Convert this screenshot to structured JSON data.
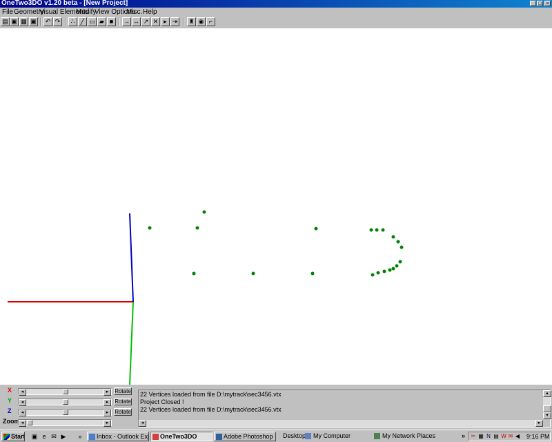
{
  "window": {
    "title": "OneTwo3DO  v1.20 beta - [New Project]"
  },
  "menu": [
    "File",
    "Geometry",
    "Visual Elements",
    "Modify",
    "View Options",
    "Misc.",
    "Help"
  ],
  "toolbar": {
    "groups": [
      [
        "open-icon",
        "save-icon",
        "save-as-icon",
        "save-all-icon"
      ],
      [
        "undo-icon",
        "redo-icon"
      ],
      [
        "vertex-icon",
        "line-icon",
        "face-icon",
        "surface-icon",
        "solid-icon"
      ],
      [
        "arrow-right-icon",
        "arrow-both-icon",
        "arrow-diagonal-icon",
        "crosshair-icon",
        "step-right-icon",
        "step-end-icon"
      ],
      [
        "render-icon",
        "view-icon",
        "pipeline-icon"
      ]
    ]
  },
  "viewport": {
    "axes": {
      "x_color": "#e00000",
      "y_color": "#0000c0",
      "z_color": "#00c000"
    },
    "vertex_color": "#008000"
  },
  "controls": {
    "rows": [
      {
        "axis": "X",
        "color": "#e00000",
        "button": "Rotate"
      },
      {
        "axis": "Y",
        "color": "#00a000",
        "button": "Rotate"
      },
      {
        "axis": "Z",
        "color": "#0000c0",
        "button": "Rotate"
      },
      {
        "axis": "Zoom",
        "color": "#000000",
        "button": ""
      }
    ]
  },
  "log": {
    "lines": [
      "22 Vertices loaded from file D:\\mytrack\\sec3456.vtx",
      "Project Closed !",
      "22 Vertices loaded from file D:\\mytrack\\sec3456.vtx"
    ]
  },
  "taskbar": {
    "start": "Start",
    "buttons": [
      {
        "label": "Inbox - Outlook Express",
        "active": false
      },
      {
        "label": "OneTwo3DO",
        "active": true
      },
      {
        "label": "Adobe Photoshop",
        "active": false
      }
    ],
    "links": [
      "Desktop",
      "My Computer",
      "My Network Places"
    ],
    "clock": "9:16 PM"
  }
}
